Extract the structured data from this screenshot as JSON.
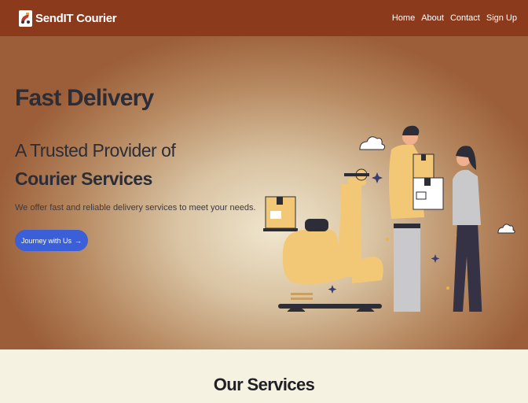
{
  "navbar": {
    "brand_name": "SendIT Courier",
    "links": [
      {
        "label": "Home"
      },
      {
        "label": "About"
      },
      {
        "label": "Contact"
      },
      {
        "label": "Sign Up"
      }
    ]
  },
  "hero": {
    "title": "Fast Delivery",
    "subtitle_line1": "A Trusted Provider of",
    "subtitle_line2": "Courier Services",
    "description": "We offer fast and reliable delivery services to meet your needs.",
    "cta_label": "Journey with Us",
    "cta_arrow": "→"
  },
  "services": {
    "title": "Our Services"
  },
  "colors": {
    "navbar_bg": "#8b3a1c",
    "cta_bg": "#3a5fd6",
    "text_dark": "#2c2d36",
    "services_bg": "#f5f2e1"
  }
}
